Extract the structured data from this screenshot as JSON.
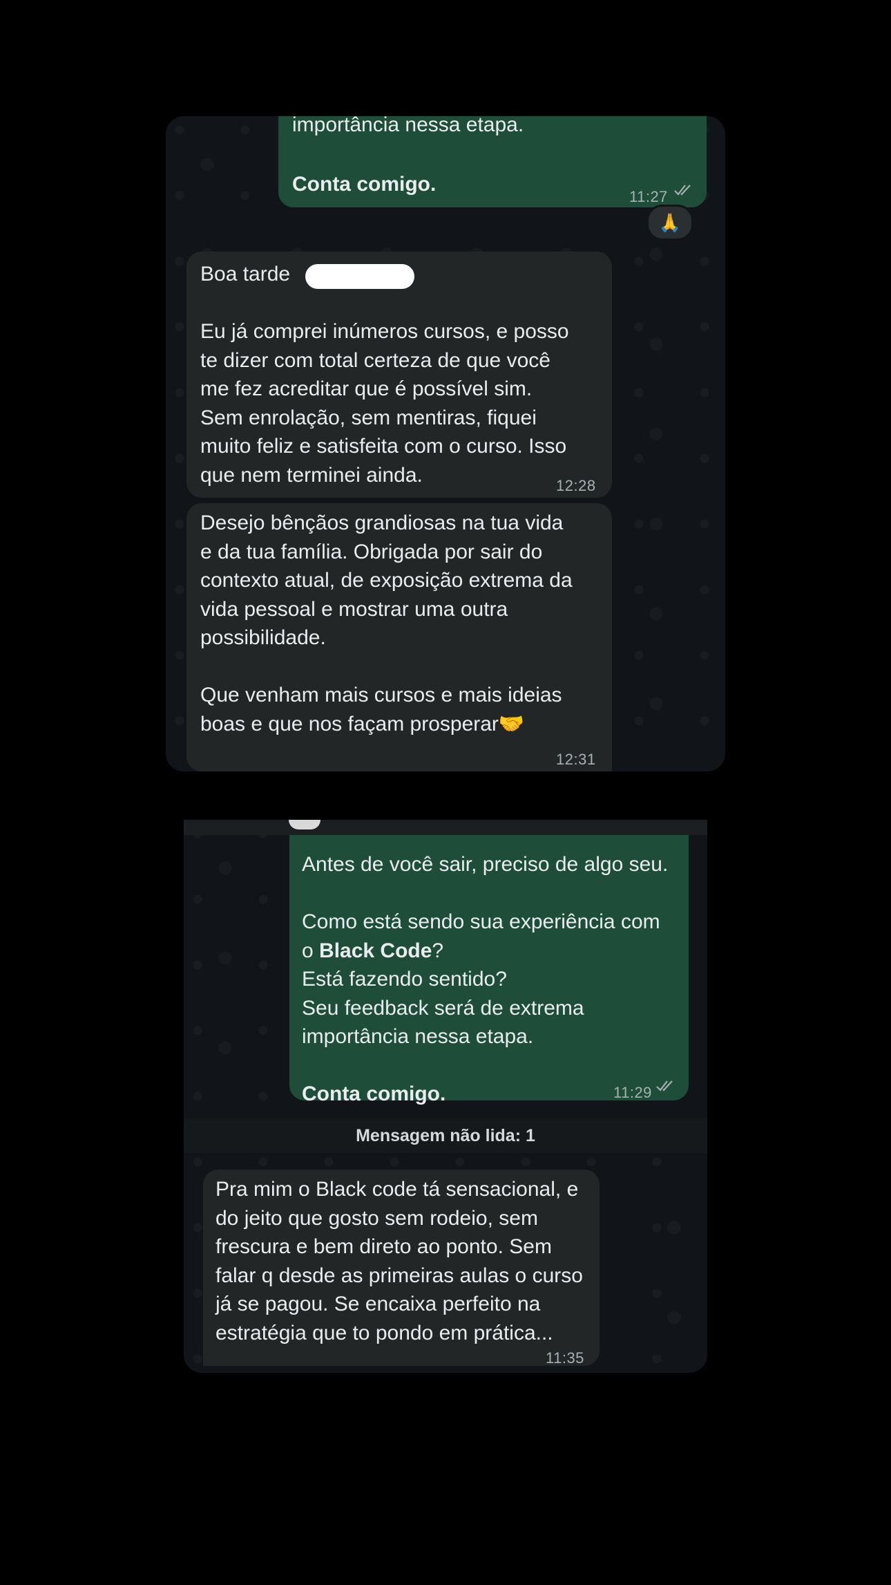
{
  "screenshot1": {
    "outgoing": {
      "fragment": "importância nessa etapa.",
      "sign_off": "Conta comigo.",
      "time": "11:27"
    },
    "reaction": "🙏",
    "incoming1": {
      "greeting": "Boa tarde",
      "body": "Eu já comprei inúmeros cursos, e posso\nte dizer com total certeza de que você\nme fez acreditar que é possível sim.\nSem enrolação, sem mentiras, fiquei\nmuito feliz e satisfeita com o curso. Isso\nque nem terminei ainda.",
      "time": "12:28"
    },
    "incoming2": {
      "body": "Desejo bênçãos grandiosas na tua vida\ne da tua família. Obrigada por sair do\ncontexto atual, de exposição extrema da\nvida pessoal e mostrar uma outra\npossibilidade.\n\nQue venham mais cursos e mais ideias\nboas e que nos façam prosperar🤝",
      "time": "12:31"
    }
  },
  "screenshot2": {
    "outgoing": {
      "line1": "Antes de você sair, preciso de algo seu.",
      "line2_pre": "Como está sendo sua experiência com\no ",
      "line2_bold": "Black Code",
      "line2_post": "?",
      "line3": "Está fazendo sentido?\nSeu feedback será de extrema\nimportância nessa etapa.",
      "sign_off": "Conta comigo.",
      "time": "11:29"
    },
    "unread_label": "Mensagem não lida: 1",
    "incoming": {
      "body": "Pra mim o Black code tá sensacional, e\ndo jeito que gosto sem rodeio, sem\nfrescura e bem direto ao ponto. Sem\nfalar q desde as primeiras aulas o curso\njá se pagou. Se encaixa perfeito na\nestratégia que to pondo em prática...",
      "time": "11:35"
    }
  },
  "colors": {
    "outgoing_bubble": "#1e4d3a",
    "incoming_bubble": "#232627",
    "chat_background": "#111519"
  }
}
